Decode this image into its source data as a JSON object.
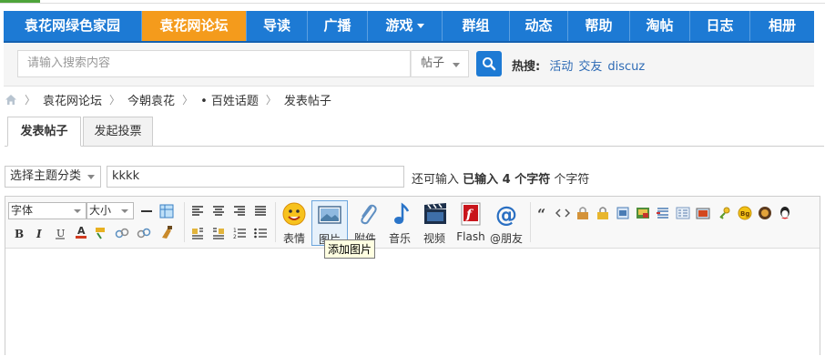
{
  "nav": {
    "items": [
      {
        "label": "袁花网绿色家园",
        "active": false
      },
      {
        "label": "袁花网论坛",
        "active": true
      },
      {
        "label": "导读",
        "active": false
      },
      {
        "label": "广播",
        "active": false
      },
      {
        "label": "游戏",
        "active": false,
        "caret": true
      },
      {
        "label": "群组",
        "active": false
      },
      {
        "label": "动态",
        "active": false
      },
      {
        "label": "帮助",
        "active": false
      },
      {
        "label": "淘帖",
        "active": false
      },
      {
        "label": "日志",
        "active": false
      },
      {
        "label": "相册",
        "active": false
      }
    ]
  },
  "search": {
    "placeholder": "请输入搜索内容",
    "type_label": "帖子",
    "hot_label": "热搜:",
    "hot_links": [
      "活动",
      "交友",
      "discuz"
    ]
  },
  "breadcrumb": {
    "items": [
      "袁花网论坛",
      "今朝袁花",
      "• 百姓话题",
      "发表帖子"
    ]
  },
  "tabs": [
    {
      "label": "发表帖子",
      "active": true
    },
    {
      "label": "发起投票",
      "active": false
    }
  ],
  "form": {
    "topic_select": "选择主题分类",
    "title_value": "kkkk",
    "counter_prefix": "还可输入",
    "counter_bold": "已输入 4 个字符",
    "counter_suffix": "个字符"
  },
  "toolbar": {
    "font_label": "字体",
    "size_label": "大小",
    "big_buttons": [
      "表情",
      "图片",
      "附件",
      "音乐",
      "视频",
      "Flash",
      "@朋友"
    ],
    "tooltip": "添加图片"
  },
  "colors": {
    "nav_bg": "#1d7ad4",
    "nav_active": "#f49b1c",
    "link": "#2e6bb5"
  }
}
